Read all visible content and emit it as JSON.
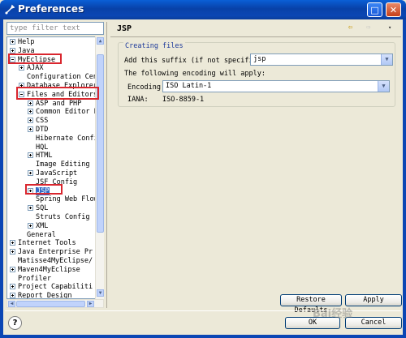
{
  "window": {
    "title": "Preferences",
    "max_glyph": "□",
    "close_glyph": "✕"
  },
  "filter": {
    "placeholder": "type filter text"
  },
  "tree": {
    "nodes": [
      {
        "label": "Help",
        "toggle": "plus"
      },
      {
        "label": "Java",
        "toggle": "plus"
      },
      {
        "label": "MyEclipse",
        "toggle": "minus"
      },
      {
        "label": "AJAX",
        "toggle": "plus"
      },
      {
        "label": "Configuration Cent",
        "toggle": "none"
      },
      {
        "label": "Database Explorer",
        "toggle": "plus"
      },
      {
        "label": "Files and Editors",
        "toggle": "minus"
      },
      {
        "label": "ASP and PHP",
        "toggle": "plus"
      },
      {
        "label": "Common Editor P",
        "toggle": "plus"
      },
      {
        "label": "CSS",
        "toggle": "plus"
      },
      {
        "label": "DTD",
        "toggle": "plus"
      },
      {
        "label": "Hibernate Confi",
        "toggle": "none"
      },
      {
        "label": "HQL",
        "toggle": "none"
      },
      {
        "label": "HTML",
        "toggle": "plus"
      },
      {
        "label": "Image Editing",
        "toggle": "none"
      },
      {
        "label": "JavaScript",
        "toggle": "plus"
      },
      {
        "label": "JSF Config",
        "toggle": "none"
      },
      {
        "label": "JSP",
        "toggle": "plus",
        "selected": true
      },
      {
        "label": "Spring Web Flow",
        "toggle": "none"
      },
      {
        "label": "SQL",
        "toggle": "plus"
      },
      {
        "label": "Struts Config",
        "toggle": "none"
      },
      {
        "label": "XML",
        "toggle": "plus"
      },
      {
        "label": "General",
        "toggle": "none"
      },
      {
        "label": "Internet Tools",
        "toggle": "plus"
      },
      {
        "label": "Java Enterprise Pr",
        "toggle": "plus"
      },
      {
        "label": "Matisse4MyEclipse/",
        "toggle": "none"
      },
      {
        "label": "Maven4MyEclipse",
        "toggle": "plus"
      },
      {
        "label": "Profiler",
        "toggle": "none"
      },
      {
        "label": "Project Capabiliti",
        "toggle": "plus"
      },
      {
        "label": "Report Design",
        "toggle": "plus"
      }
    ]
  },
  "page": {
    "title": "JSP",
    "nav_back": "⇦",
    "nav_forward": "⇨",
    "nav_menu": "▾",
    "group_title": "Creating files",
    "suffix_label": "Add this suffix (if not specified):",
    "suffix_value": "jsp",
    "encoding_note": "The following encoding will apply:",
    "encoding_label": "Encoding:",
    "encoding_value": "ISO Latin-1",
    "iana_label": "IANA:",
    "iana_value": "ISO-8859-1",
    "dropdown_glyph": "▼"
  },
  "buttons": {
    "restore_defaults": "Restore Defaults",
    "apply": "Apply",
    "ok": "OK",
    "cancel": "Cancel",
    "help": "?"
  },
  "scroll": {
    "up": "▲",
    "down": "▼",
    "left": "◀",
    "right": "▶"
  },
  "watermark": "Bai经验"
}
